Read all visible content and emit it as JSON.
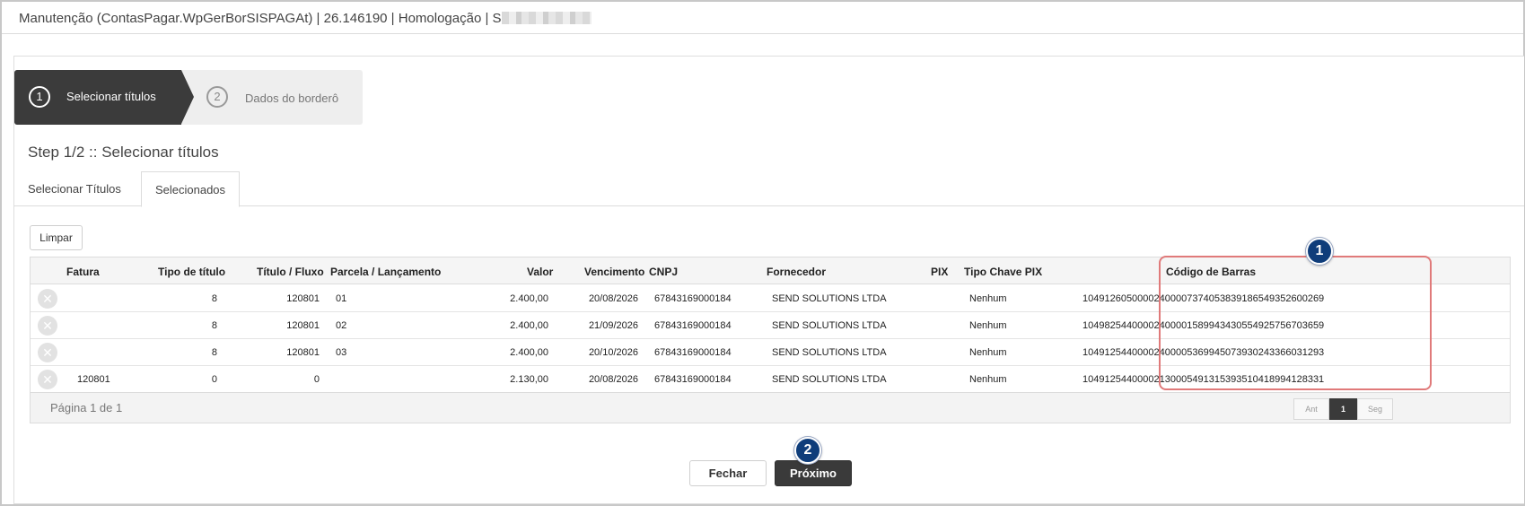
{
  "titlebar": {
    "title": "Manutenção (ContasPagar.WpGerBorSISPAGAt) | 26.146190 | Homologação | S"
  },
  "wizard": {
    "steps": [
      {
        "number": "1",
        "label": "Selecionar títulos"
      },
      {
        "number": "2",
        "label": "Dados do borderô"
      }
    ]
  },
  "step_title": "Step 1/2 :: Selecionar títulos",
  "tabs": [
    {
      "label": "Selecionar Títulos"
    },
    {
      "label": "Selecionados"
    }
  ],
  "actions": {
    "clear_label": "Limpar"
  },
  "table": {
    "columns": [
      "Fatura",
      "Tipo de título",
      "Título / Fluxo",
      "Parcela / Lançamento",
      "Valor",
      "Vencimento",
      "CNPJ",
      "Fornecedor",
      "PIX",
      "Tipo Chave PIX",
      "Código de Barras"
    ],
    "remove_glyph": "✕",
    "rows": [
      {
        "fatura": "",
        "tipo": "8",
        "titulo": "120801",
        "parcela": "01",
        "valor": "2.400,00",
        "vencimento": "20/08/2026",
        "cnpj": "67843169000184",
        "fornecedor": "SEND SOLUTIONS LTDA",
        "pix": "",
        "tipo_chave": "Nenhum",
        "codigo": "10491260500002400007374053839186549352600269"
      },
      {
        "fatura": "",
        "tipo": "8",
        "titulo": "120801",
        "parcela": "02",
        "valor": "2.400,00",
        "vencimento": "21/09/2026",
        "cnpj": "67843169000184",
        "fornecedor": "SEND SOLUTIONS LTDA",
        "pix": "",
        "tipo_chave": "Nenhum",
        "codigo": "10498254400002400001589943430554925756703659"
      },
      {
        "fatura": "",
        "tipo": "8",
        "titulo": "120801",
        "parcela": "03",
        "valor": "2.400,00",
        "vencimento": "20/10/2026",
        "cnpj": "67843169000184",
        "fornecedor": "SEND SOLUTIONS LTDA",
        "pix": "",
        "tipo_chave": "Nenhum",
        "codigo": "10491254400002400005369945073930243366031293"
      },
      {
        "fatura": "120801",
        "tipo": "0",
        "titulo": "0",
        "parcela": "",
        "valor": "2.130,00",
        "vencimento": "20/08/2026",
        "cnpj": "67843169000184",
        "fornecedor": "SEND SOLUTIONS LTDA",
        "pix": "",
        "tipo_chave": "Nenhum",
        "codigo": "10491254400002130005491315393510418994128331"
      }
    ]
  },
  "pager": {
    "info": "Página 1 de 1",
    "prev_label": "Ant",
    "current": "1",
    "next_label": "Seg"
  },
  "annotations": {
    "badge_1": "1",
    "badge_2": "2"
  },
  "footer": {
    "close_label": "Fechar",
    "next_label": "Próximo"
  },
  "colors": {
    "wizard_active": "#3b3b3b",
    "highlight_border": "#e07a7a",
    "badge": "#0f3d7a",
    "primary_button": "#3a3a3a"
  }
}
